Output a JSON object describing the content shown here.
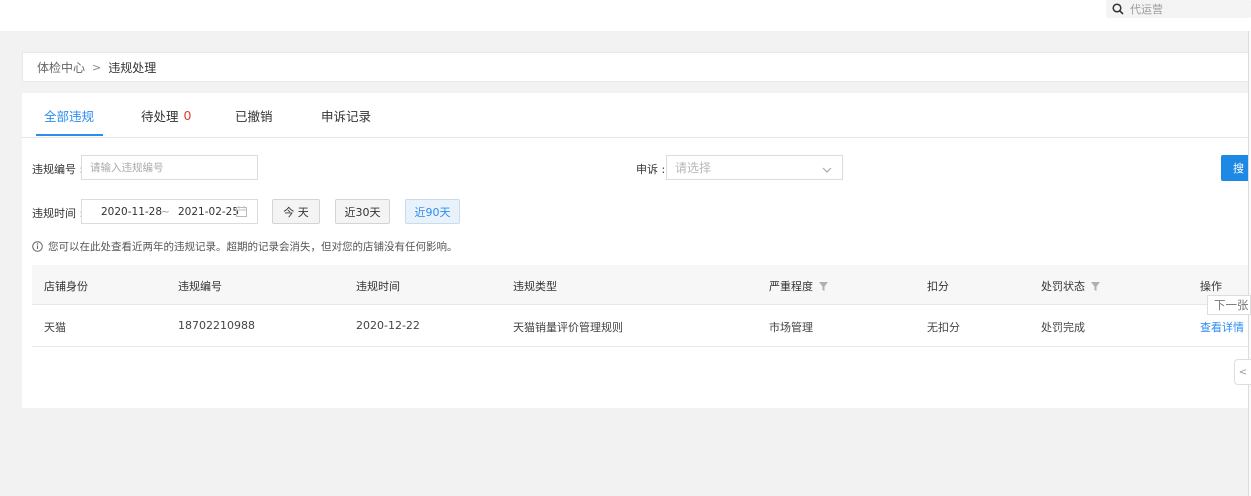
{
  "topbar": {
    "search_placeholder": "代运营"
  },
  "breadcrumb": {
    "root": "体检中心",
    "separator": ">",
    "current": "违规处理"
  },
  "tabs": [
    {
      "label": "全部违规",
      "active": true
    },
    {
      "label": "待处理",
      "badge": "0"
    },
    {
      "label": "已撤销"
    },
    {
      "label": "申诉记录"
    }
  ],
  "filters": {
    "violation_no_label": "违规编号 :",
    "violation_no_placeholder": "请输入违规编号",
    "appeal_label": "申诉 :",
    "appeal_placeholder": "请选择",
    "search_button": "搜",
    "time_label": "违规时间 :",
    "date_start": "2020-11-28",
    "date_sep": "~",
    "date_end": "2021-02-25",
    "quick_today": "今 天",
    "quick_30": "近30天",
    "quick_90": "近90天",
    "active_quick": "近90天"
  },
  "notice": "您可以在此处查看近两年的违规记录。超期的记录会消失，但对您的店铺没有任何影响。",
  "table": {
    "columns": [
      "店铺身份",
      "违规编号",
      "违规时间",
      "违规类型",
      "严重程度",
      "扣分",
      "处罚状态",
      "操作"
    ],
    "rows": [
      {
        "shop": "天猫",
        "no": "18702210988",
        "time": "2020-12-22",
        "type": "天猫销量评价管理规则",
        "severity": "市场管理",
        "points": "无扣分",
        "status": "处罚完成",
        "action": "查看详情"
      }
    ]
  },
  "overlay": {
    "next_tip": "下一张",
    "side_handle": "<"
  },
  "colors": {
    "accent": "#2d8cf0",
    "badge": "#e23c2a",
    "search_button": "#1e88e5"
  }
}
